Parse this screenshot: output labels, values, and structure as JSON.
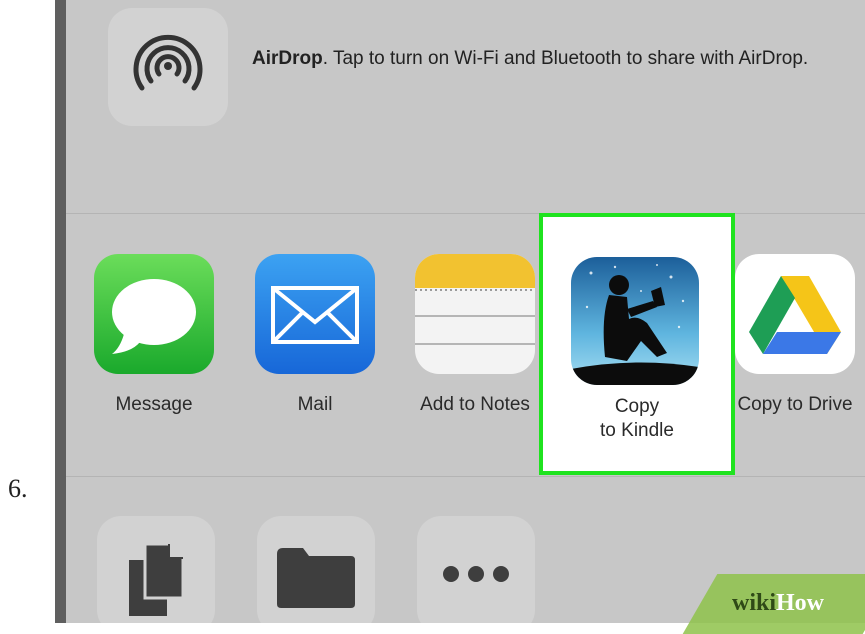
{
  "step": {
    "number": "6."
  },
  "airdrop": {
    "title": "AirDrop",
    "message": ". Tap to turn on Wi-Fi and Bluetooth to share with AirDrop.",
    "icon": "airdrop-icon"
  },
  "share_apps": [
    {
      "label": "Message",
      "icon": "message-icon"
    },
    {
      "label": "Mail",
      "icon": "mail-icon"
    },
    {
      "label": "Add to Notes",
      "icon": "notes-icon"
    },
    {
      "label_line1": "Copy",
      "label_line2": "to Kindle",
      "icon": "kindle-icon",
      "highlighted": true
    },
    {
      "label": "Copy to Drive",
      "icon": "google-drive-icon"
    }
  ],
  "actions": [
    {
      "icon": "copy-documents-icon"
    },
    {
      "icon": "folder-icon"
    },
    {
      "icon": "more-icon"
    }
  ],
  "colors": {
    "highlight": "#1fe31f",
    "sheet_background": "#c7c7c7"
  },
  "watermark": {
    "part1": "wiki",
    "part2": "How"
  }
}
